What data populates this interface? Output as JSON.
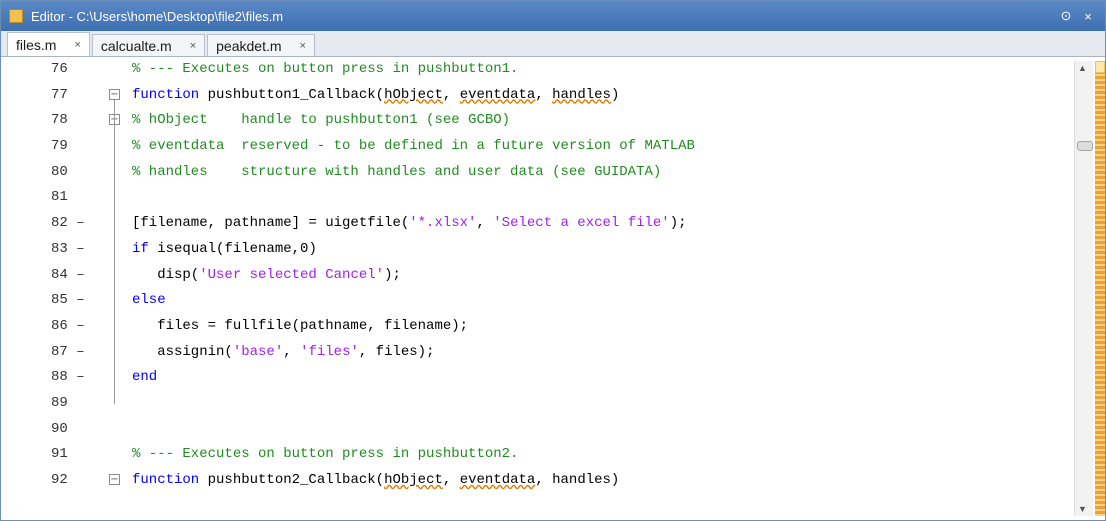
{
  "window": {
    "title": "Editor - C:\\Users\\home\\Desktop\\file2\\files.m"
  },
  "tabs": [
    {
      "label": "files.m",
      "close": "×"
    },
    {
      "label": "calcualte.m",
      "close": "×"
    },
    {
      "label": "peakdet.m",
      "close": "×"
    }
  ],
  "icons": {
    "window_menu": "⊙",
    "close": "×",
    "fold_minus": "−",
    "scroll_up": "▲",
    "scroll_down": "▼"
  },
  "colors": {
    "keyword": "#0000ff",
    "comment": "#228b22",
    "string": "#a020f0",
    "warning_marker": "#f0a030"
  },
  "lines": [
    {
      "num": "76",
      "seg": [
        {
          "t": "% --- Executes on button press in pushbutton1.",
          "c": "cm"
        }
      ]
    },
    {
      "num": "77",
      "seg": [
        {
          "t": "function",
          "c": "kw"
        },
        {
          "t": " pushbutton1_Callback("
        },
        {
          "t": "hObject",
          "c": "ul"
        },
        {
          "t": ", "
        },
        {
          "t": "eventdata",
          "c": "ul"
        },
        {
          "t": ", "
        },
        {
          "t": "handles",
          "c": "ul"
        },
        {
          "t": ")"
        }
      ]
    },
    {
      "num": "78",
      "seg": [
        {
          "t": "% hObject    handle to pushbutton1 (see GCBO)",
          "c": "cm"
        }
      ]
    },
    {
      "num": "79",
      "seg": [
        {
          "t": "% eventdata  reserved - to be defined in a future version of MATLAB",
          "c": "cm"
        }
      ]
    },
    {
      "num": "80",
      "seg": [
        {
          "t": "% handles    structure with handles and user data (see GUIDATA)",
          "c": "cm"
        }
      ]
    },
    {
      "num": "81",
      "seg": []
    },
    {
      "num": "82 –",
      "seg": [
        {
          "t": "[filename, pathname] = uigetfile("
        },
        {
          "t": "'*.xlsx'",
          "c": "st"
        },
        {
          "t": ", "
        },
        {
          "t": "'Select a excel file'",
          "c": "st"
        },
        {
          "t": ");"
        }
      ]
    },
    {
      "num": "83 –",
      "seg": [
        {
          "t": "if",
          "c": "kw"
        },
        {
          "t": " isequal(filename,0)"
        }
      ]
    },
    {
      "num": "84 –",
      "seg": [
        {
          "t": "   disp("
        },
        {
          "t": "'User selected Cancel'",
          "c": "st"
        },
        {
          "t": ");"
        }
      ]
    },
    {
      "num": "85 –",
      "seg": [
        {
          "t": "else",
          "c": "kw"
        }
      ]
    },
    {
      "num": "86 –",
      "seg": [
        {
          "t": "   files = fullfile(pathname, filename);"
        }
      ]
    },
    {
      "num": "87 –",
      "seg": [
        {
          "t": "   assignin("
        },
        {
          "t": "'base'",
          "c": "st"
        },
        {
          "t": ", "
        },
        {
          "t": "'files'",
          "c": "st"
        },
        {
          "t": ", files);"
        }
      ]
    },
    {
      "num": "88 –",
      "seg": [
        {
          "t": "end",
          "c": "kw"
        }
      ]
    },
    {
      "num": "89",
      "seg": []
    },
    {
      "num": "90",
      "seg": []
    },
    {
      "num": "91",
      "seg": [
        {
          "t": "% --- Executes on button press in pushbutton2.",
          "c": "cm"
        }
      ]
    },
    {
      "num": "92",
      "seg": [
        {
          "t": "function",
          "c": "kw"
        },
        {
          "t": " pushbutton2_Callback("
        },
        {
          "t": "hObject",
          "c": "ul"
        },
        {
          "t": ", "
        },
        {
          "t": "eventdata",
          "c": "ul"
        },
        {
          "t": ", handles)"
        }
      ]
    }
  ]
}
